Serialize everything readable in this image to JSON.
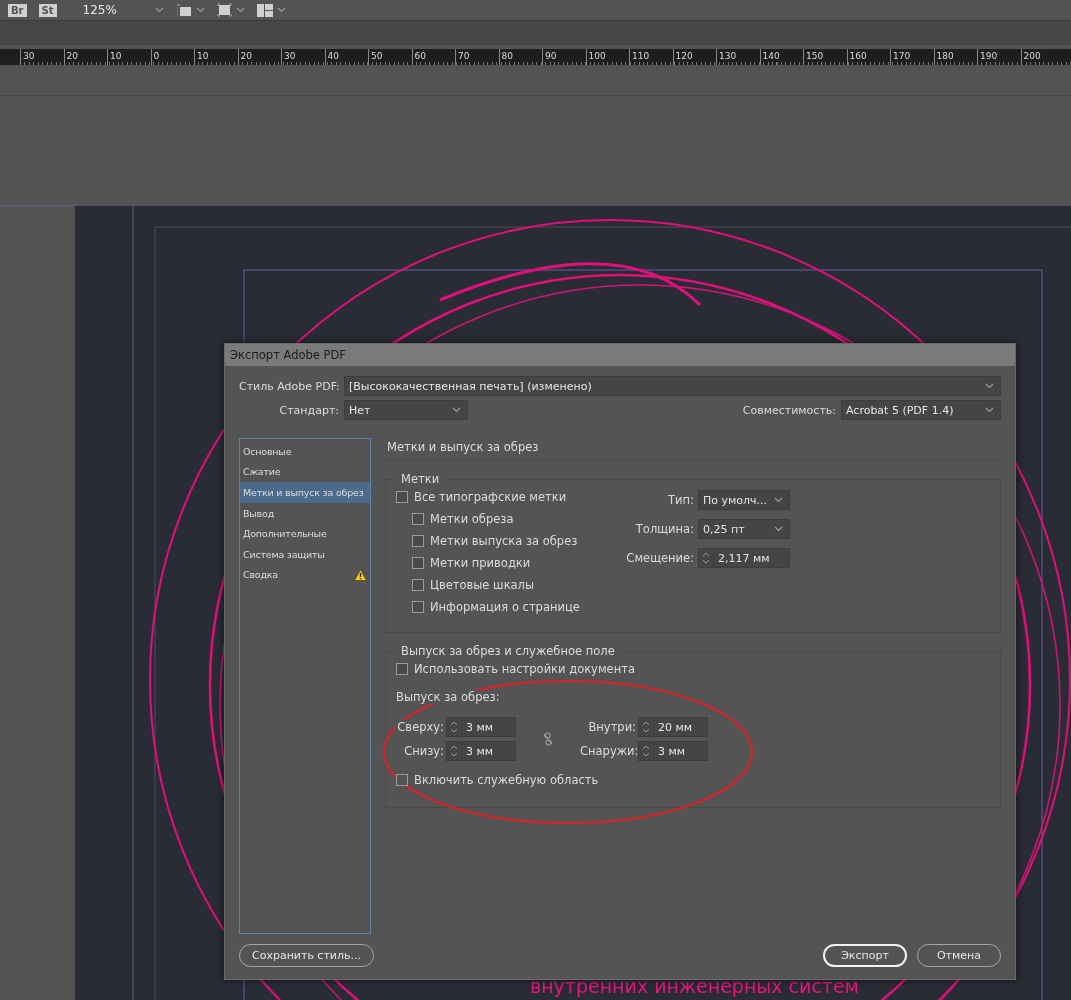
{
  "toolbar": {
    "badges": [
      "Br",
      "St"
    ],
    "zoom": "125%"
  },
  "ruler": {
    "labels": [
      "30",
      "20",
      "10",
      "0",
      "10",
      "20",
      "30",
      "40",
      "50",
      "60",
      "70",
      "80",
      "90",
      "100",
      "110",
      "120",
      "130",
      "140",
      "150",
      "160",
      "170",
      "180",
      "190",
      "200"
    ]
  },
  "canvas": {
    "caption": "внутренних инженерных систем"
  },
  "dialog": {
    "title": "Экспорт Adobe PDF",
    "style": {
      "label": "Стиль Adobe PDF:",
      "value": "[Высококачественная печать] (изменено)"
    },
    "standard": {
      "label": "Стандарт:",
      "value": "Нет"
    },
    "compatibility": {
      "label": "Совместимость:",
      "value": "Acrobat 5 (PDF 1.4)"
    },
    "sections": [
      {
        "label": "Основные",
        "selected": false,
        "warning": false
      },
      {
        "label": "Сжатие",
        "selected": false,
        "warning": false
      },
      {
        "label": "Метки и выпуск за обрез",
        "selected": true,
        "warning": false
      },
      {
        "label": "Вывод",
        "selected": false,
        "warning": false
      },
      {
        "label": "Дополнительные",
        "selected": false,
        "warning": false
      },
      {
        "label": "Система защиты",
        "selected": false,
        "warning": false
      },
      {
        "label": "Сводка",
        "selected": false,
        "warning": true
      }
    ],
    "panel_title": "Метки и выпуск за обрез",
    "marks": {
      "title": "Метки",
      "all": {
        "label": "Все типографские метки",
        "checked": false
      },
      "items": [
        {
          "label": "Метки обреза",
          "checked": false
        },
        {
          "label": "Метки выпуска за обрез",
          "checked": false
        },
        {
          "label": "Метки приводки",
          "checked": false
        },
        {
          "label": "Цветовые шкалы",
          "checked": false
        },
        {
          "label": "Информация о странице",
          "checked": false
        }
      ],
      "type": {
        "label": "Тип:",
        "value": "По умолч..."
      },
      "weight": {
        "label": "Толщина:",
        "value": "0,25 пт"
      },
      "offset": {
        "label": "Смещение:",
        "value": "2,117 мм"
      }
    },
    "bleed": {
      "title": "Выпуск за обрез и служебное поле",
      "use_document": {
        "label": "Использовать настройки документа",
        "checked": false
      },
      "subtitle": "Выпуск за обрез:",
      "fields": [
        {
          "label": "Сверху:",
          "value": "3 мм"
        },
        {
          "label": "Внутри:",
          "value": "20 мм"
        },
        {
          "label": "Снизу:",
          "value": "3 мм"
        },
        {
          "label": "Снаружи:",
          "value": "3 мм"
        }
      ],
      "linked": false,
      "slug": {
        "label": "Включить служебную область",
        "checked": false
      }
    },
    "buttons": {
      "save_style": "Сохранить стиль...",
      "export": "Экспорт",
      "cancel": "Отмена"
    }
  }
}
